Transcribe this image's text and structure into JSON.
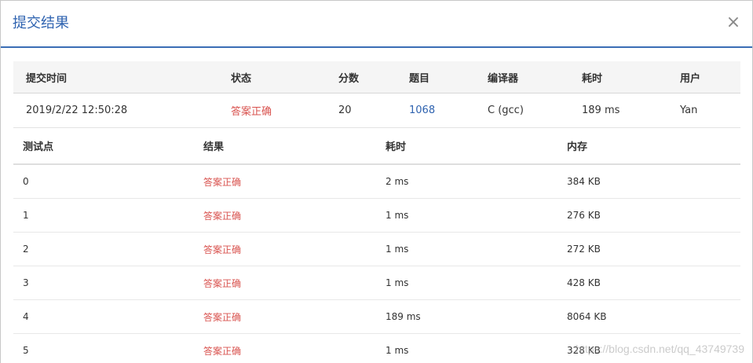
{
  "modal": {
    "title": "提交结果",
    "close_symbol": "×"
  },
  "summary": {
    "headers": [
      "提交时间",
      "状态",
      "分数",
      "题目",
      "编译器",
      "耗时",
      "用户"
    ],
    "row": {
      "time": "2019/2/22 12:50:28",
      "status": "答案正确",
      "score": "20",
      "problem": "1068",
      "compiler": "C (gcc)",
      "elapsed": "189 ms",
      "user": "Yan"
    }
  },
  "cases": {
    "headers": [
      "测试点",
      "结果",
      "耗时",
      "内存"
    ],
    "rows": [
      {
        "id": "0",
        "result": "答案正确",
        "time": "2 ms",
        "memory": "384 KB"
      },
      {
        "id": "1",
        "result": "答案正确",
        "time": "1 ms",
        "memory": "276 KB"
      },
      {
        "id": "2",
        "result": "答案正确",
        "time": "1 ms",
        "memory": "272 KB"
      },
      {
        "id": "3",
        "result": "答案正确",
        "time": "1 ms",
        "memory": "428 KB"
      },
      {
        "id": "4",
        "result": "答案正确",
        "time": "189 ms",
        "memory": "8064 KB"
      },
      {
        "id": "5",
        "result": "答案正确",
        "time": "1 ms",
        "memory": "328 KB"
      }
    ]
  },
  "watermark": "https://blog.csdn.net/qq_43749739",
  "colors": {
    "accent": "#2f63b0",
    "success": "#d9534f"
  }
}
